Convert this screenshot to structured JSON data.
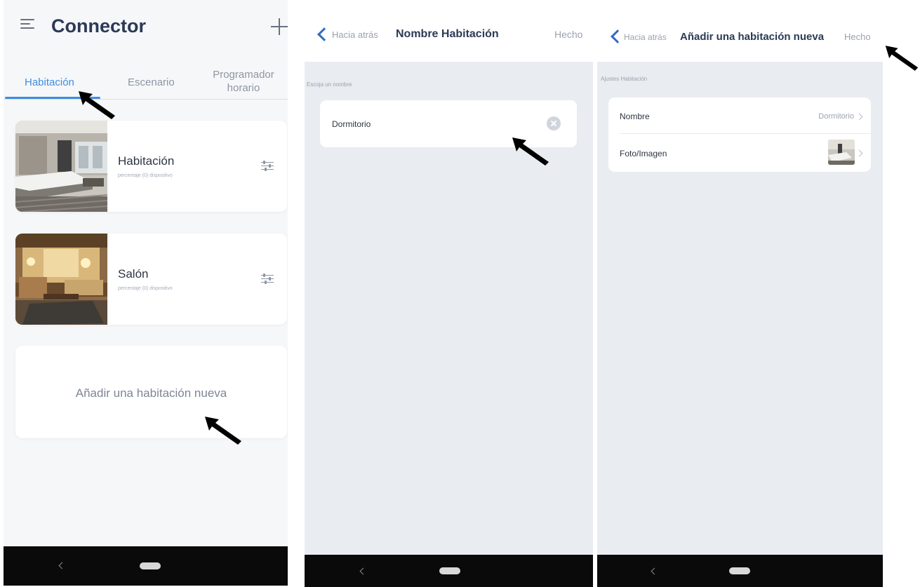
{
  "screen1": {
    "title": "Connector",
    "tabs": [
      {
        "label": "Habitación"
      },
      {
        "label": "Escenario"
      },
      {
        "label": "Programador horario"
      }
    ],
    "rooms": [
      {
        "name": "Habitación",
        "subtitle": "percentaje (0) dispositivo"
      },
      {
        "name": "Salón",
        "subtitle": "percentaje (0) dispositivo"
      }
    ],
    "add_room_label": "Añadir una habitación nueva"
  },
  "screen2": {
    "back_label": "Hacia atrás",
    "title": "Nombre Habitación",
    "done_label": "Hecho",
    "section_label": "Escoja un nombre",
    "name_value": "Dormitorio"
  },
  "screen3": {
    "back_label": "Hacia atrás",
    "title": "Añadir una habitación nueva",
    "done_label": "Hecho",
    "section_label": "Ajustes Habitación",
    "rows": [
      {
        "label": "Nombre",
        "value": "Dormitorio"
      },
      {
        "label": "Foto/Imagen"
      }
    ]
  },
  "colors": {
    "accent": "#3d8de0",
    "title": "#2b3a55",
    "navbar": "#0a0a0a"
  }
}
